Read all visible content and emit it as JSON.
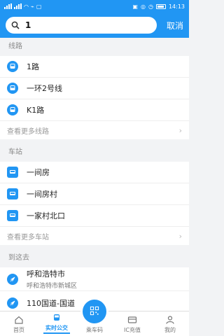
{
  "status": {
    "time": "14:13"
  },
  "search": {
    "query": "1",
    "cancel": "取消"
  },
  "sections": {
    "lines_title": "线路",
    "lines": [
      "1路",
      "一环2号线",
      "K1路"
    ],
    "lines_more": "查看更多线路",
    "stations_title": "车站",
    "stations": [
      "一间房",
      "一间房村",
      "一家村北口"
    ],
    "stations_more": "查看更多车站",
    "dest_title": "到这去",
    "dest": [
      {
        "name": "呼和浩特市",
        "sub": "呼和浩特市新城区"
      },
      {
        "name": "110国道-国道",
        "sub": ""
      }
    ]
  },
  "tabs": {
    "home": "首页",
    "realtime": "实时公交",
    "qr": "乘车码",
    "ic": "IC充值",
    "mine": "我的"
  },
  "colors": {
    "accent": "#2196f3"
  }
}
